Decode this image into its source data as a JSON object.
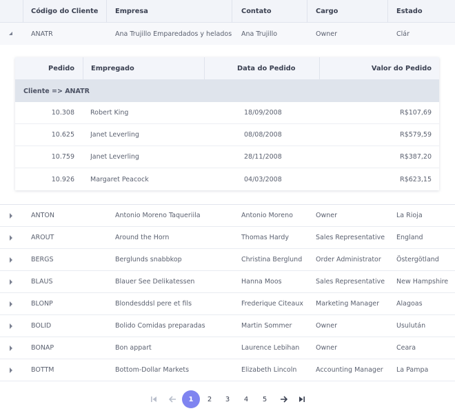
{
  "grid": {
    "columns": [
      "Código do Cliente",
      "Empresa",
      "Contato",
      "Cargo",
      "Estado"
    ],
    "expanded_row": {
      "id": "ANATR",
      "company": "Ana Trujillo Emparedados y helados",
      "contact": "Ana Trujillo",
      "title": "Owner",
      "state": "Clár"
    },
    "rows": [
      {
        "id": "ANTON",
        "company": "Antonio Moreno Taqueriila",
        "contact": "Antonio Moreno",
        "title": "Owner",
        "state": "La Rioja"
      },
      {
        "id": "AROUT",
        "company": "Around the Horn",
        "contact": "Thomas Hardy",
        "title": "Sales Representative",
        "state": "England"
      },
      {
        "id": "BERGS",
        "company": "Berglunds snabbkop",
        "contact": "Christina Berglund",
        "title": "Order Administrator",
        "state": "Östergötland"
      },
      {
        "id": "BLAUS",
        "company": "Blauer See Delikatessen",
        "contact": "Hanna Moos",
        "title": "Sales Representative",
        "state": "New Hampshire"
      },
      {
        "id": "BLONP",
        "company": "Blondesddsl pere et fils",
        "contact": "Frederique Citeaux",
        "title": "Marketing Manager",
        "state": "Alagoas"
      },
      {
        "id": "BOLID",
        "company": "Bolido Comidas preparadas",
        "contact": "Martin Sommer",
        "title": "Owner",
        "state": "Usulután"
      },
      {
        "id": "BONAP",
        "company": "Bon appart",
        "contact": "Laurence Lebihan",
        "title": "Owner",
        "state": "Ceara"
      },
      {
        "id": "BOTTM",
        "company": "Bottom-Dollar Markets",
        "contact": "Elizabeth Lincoln",
        "title": "Accounting Manager",
        "state": "La Pampa"
      }
    ]
  },
  "detail": {
    "columns": [
      "Pedido",
      "Empregado",
      "Data do Pedido",
      "Valor do Pedido"
    ],
    "group_label": "Cliente => ANATR",
    "orders": [
      {
        "order": "10.308",
        "employee": "Robert King",
        "date": "18/09/2008",
        "value": "R$107,69"
      },
      {
        "order": "10.625",
        "employee": "Janet Leverling",
        "date": "08/08/2008",
        "value": "R$579,59"
      },
      {
        "order": "10.759",
        "employee": "Janet Leverling",
        "date": "28/11/2008",
        "value": "R$387,20"
      },
      {
        "order": "10.926",
        "employee": "Margaret Peacock",
        "date": "04/03/2008",
        "value": "R$623,15"
      }
    ]
  },
  "pager": {
    "pages": [
      "1",
      "2",
      "3",
      "4",
      "5"
    ],
    "current_page": "1",
    "icons": [
      "first-page-icon",
      "prev-page-icon",
      "next-page-icon",
      "last-page-icon"
    ]
  }
}
